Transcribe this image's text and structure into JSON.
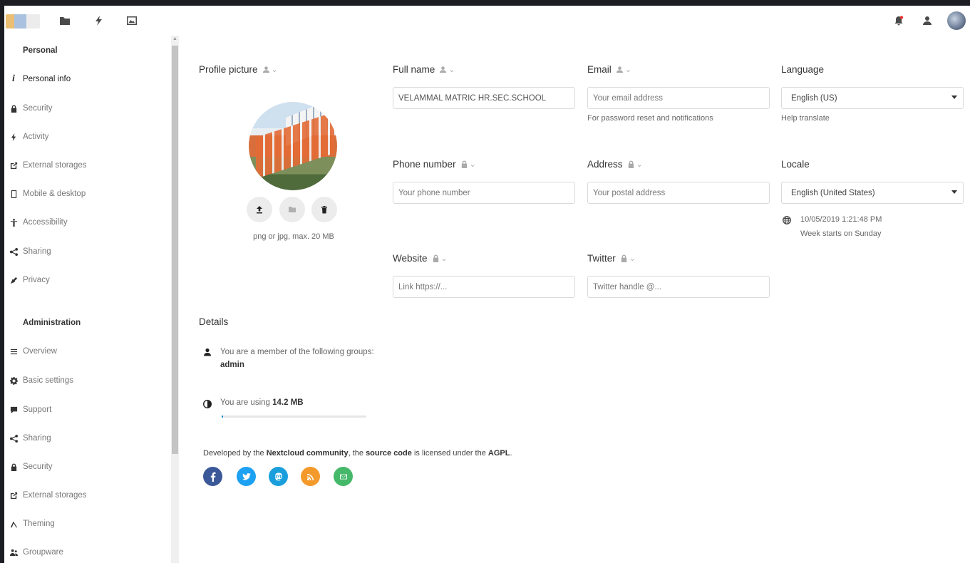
{
  "header": {
    "icons": [
      "files-icon",
      "activity-icon",
      "photos-icon"
    ],
    "right_icons": [
      "notifications-icon",
      "contacts-icon"
    ]
  },
  "sidebar": {
    "personal_title": "Personal",
    "personal_items": [
      {
        "label": "Personal info",
        "icon": "info-icon",
        "active": true
      },
      {
        "label": "Security",
        "icon": "lock-icon"
      },
      {
        "label": "Activity",
        "icon": "activity-icon"
      },
      {
        "label": "External storages",
        "icon": "external-icon"
      },
      {
        "label": "Mobile & desktop",
        "icon": "mobile-icon"
      },
      {
        "label": "Accessibility",
        "icon": "accessibility-icon"
      },
      {
        "label": "Sharing",
        "icon": "share-icon"
      },
      {
        "label": "Privacy",
        "icon": "privacy-icon"
      }
    ],
    "admin_title": "Administration",
    "admin_items": [
      {
        "label": "Overview",
        "icon": "list-icon"
      },
      {
        "label": "Basic settings",
        "icon": "gear-icon"
      },
      {
        "label": "Support",
        "icon": "support-icon"
      },
      {
        "label": "Sharing",
        "icon": "share-icon"
      },
      {
        "label": "Security",
        "icon": "lock-icon"
      },
      {
        "label": "External storages",
        "icon": "external-icon"
      },
      {
        "label": "Theming",
        "icon": "theming-icon"
      },
      {
        "label": "Groupware",
        "icon": "groupware-icon"
      }
    ]
  },
  "profile": {
    "title": "Profile picture",
    "hint": "png or jpg, max. 20 MB"
  },
  "fullname": {
    "label": "Full name",
    "value": "VELAMMAL MATRIC HR.SEC.SCHOOL"
  },
  "email": {
    "label": "Email",
    "placeholder": "Your email address",
    "hint": "For password reset and notifications"
  },
  "language": {
    "label": "Language",
    "value": "English (US)",
    "hint": "Help translate"
  },
  "phone": {
    "label": "Phone number",
    "placeholder": "Your phone number"
  },
  "address": {
    "label": "Address",
    "placeholder": "Your postal address"
  },
  "locale": {
    "label": "Locale",
    "value": "English (United States)",
    "time": "10/05/2019 1:21:48 PM",
    "week": "Week starts on Sunday"
  },
  "website": {
    "label": "Website",
    "placeholder": "Link https://..."
  },
  "twitter": {
    "label": "Twitter",
    "placeholder": "Twitter handle @..."
  },
  "details": {
    "title": "Details",
    "groups_text": "You are a member of the following groups:",
    "group": "admin",
    "usage_prefix": "You are using",
    "usage_value": "14.2 MB",
    "usage_fraction": 0.01
  },
  "footer": {
    "prefix": "Developed by the",
    "link": "Nextcloud community",
    "middle": ", the",
    "link2": "source code",
    "suffix": "is licensed under the",
    "license": "AGPL"
  },
  "social": [
    {
      "name": "facebook",
      "color": "#3b5998"
    },
    {
      "name": "twitter",
      "color": "#1da1f2"
    },
    {
      "name": "mastodon",
      "color": "#1b9fdc"
    },
    {
      "name": "rss",
      "color": "#f49a2b"
    },
    {
      "name": "mail",
      "color": "#45b86a"
    }
  ]
}
